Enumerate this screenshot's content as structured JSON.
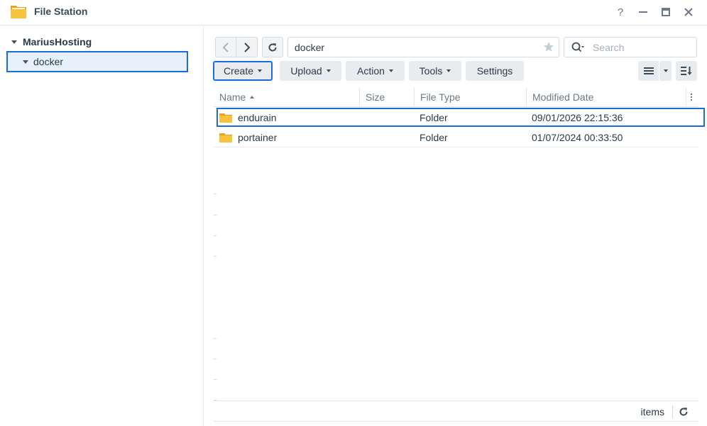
{
  "window": {
    "title": "File Station",
    "help_label": "?"
  },
  "sidebar": {
    "root_label": "MariusHosting",
    "items": [
      {
        "label": "docker"
      }
    ]
  },
  "toolbar": {
    "path": "docker",
    "search_placeholder": "Search",
    "buttons": [
      {
        "label": "Create"
      },
      {
        "label": "Upload"
      },
      {
        "label": "Action"
      },
      {
        "label": "Tools"
      },
      {
        "label": "Settings"
      }
    ]
  },
  "table": {
    "columns": [
      "Name",
      "Size",
      "File Type",
      "Modified Date"
    ],
    "rows": [
      {
        "name": "endurain",
        "size": "",
        "type": "Folder",
        "modified": "09/01/2026 22:15:36"
      },
      {
        "name": "portainer",
        "size": "",
        "type": "Folder",
        "modified": "01/07/2024 00:33:50"
      }
    ]
  },
  "footer": {
    "items_label": "items"
  },
  "icons": {
    "app": "file-station-folder-icon",
    "folder": "folder-icon",
    "search": "search-icon",
    "star": "star-icon",
    "refresh": "refresh-icon",
    "list_view": "list-view-icon",
    "sort": "sort-icon"
  },
  "colors": {
    "accent": "#1c6ce0",
    "selection_bg": "#e7f1fc",
    "folder": "#f7c33c",
    "button_bg": "#e9ecef"
  }
}
